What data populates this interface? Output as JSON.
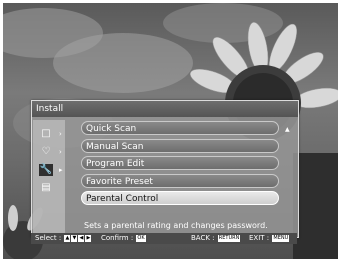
{
  "menu": {
    "title": "Install",
    "items": [
      {
        "label": "Quick Scan"
      },
      {
        "label": "Manual Scan"
      },
      {
        "label": "Program Edit"
      },
      {
        "label": "Favorite Preset"
      },
      {
        "label": "Parental Control",
        "selected": true
      }
    ],
    "description": "Sets a parental rating and changes password.",
    "side_icons": [
      "tv-icon",
      "heart-icon",
      "wrench-icon",
      "toolbox-icon"
    ]
  },
  "help": {
    "select_label": "Select :",
    "confirm_label": "Confirm :",
    "confirm_key": "OK",
    "back_label": "BACK :",
    "back_key": "RETURN",
    "exit_label": "EXIT :",
    "exit_key": "MENU"
  }
}
